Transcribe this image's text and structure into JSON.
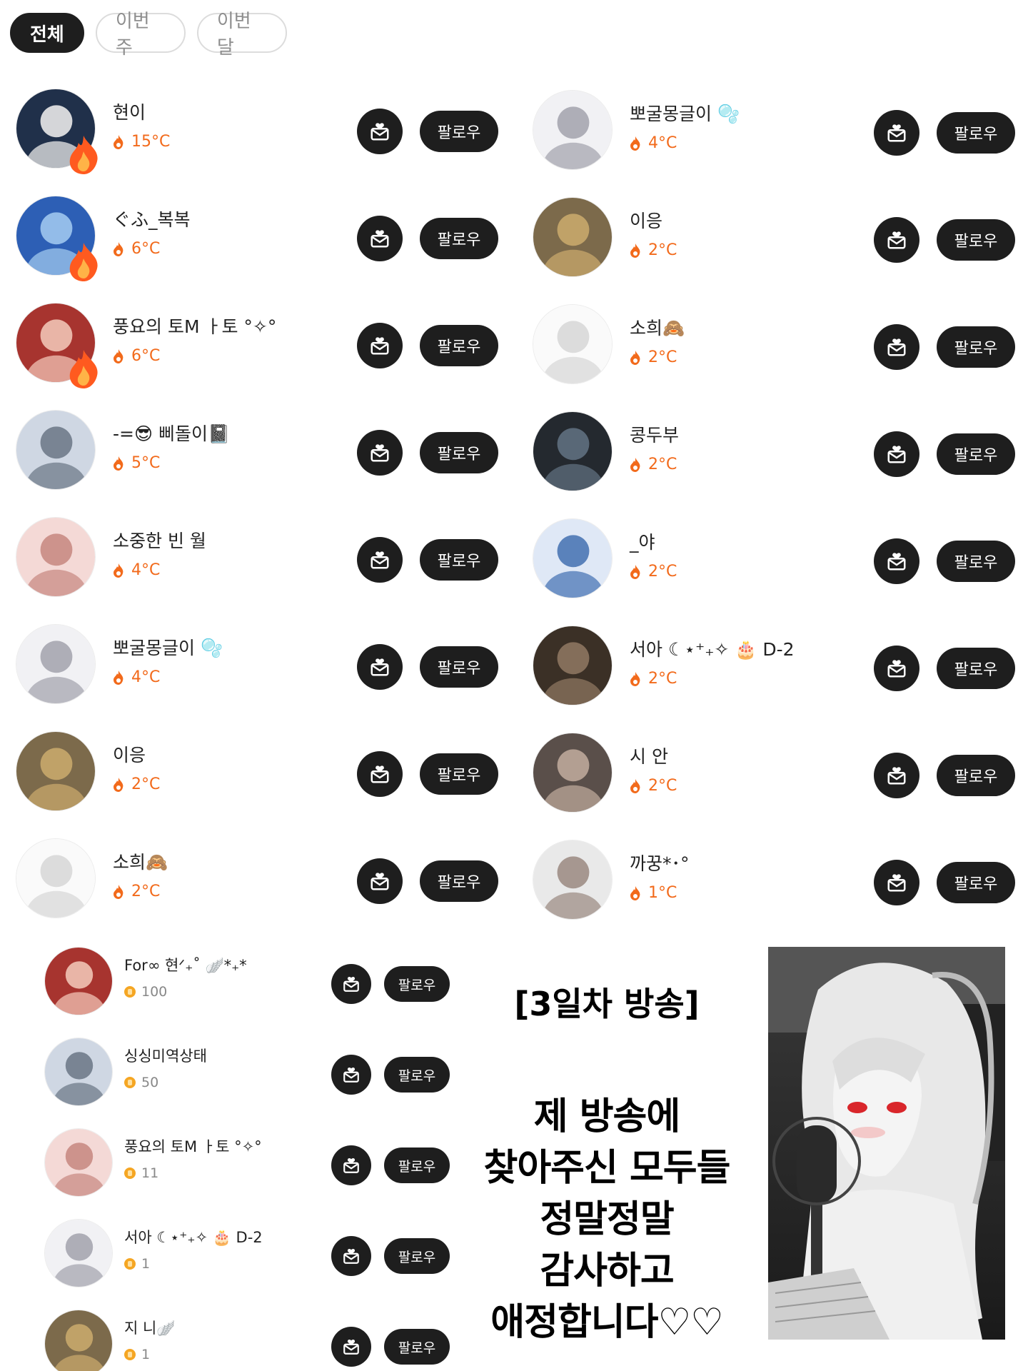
{
  "tabs": [
    {
      "label": "전체",
      "active": true
    },
    {
      "label": "이번 주",
      "active": false
    },
    {
      "label": "이번 달",
      "active": false
    }
  ],
  "follow_label": "팔로우",
  "left_list": [
    {
      "name": "현이",
      "temp": "15°C"
    },
    {
      "name": "ぐふ_복복",
      "temp": "6°C"
    },
    {
      "name": "풍요의 토M ㅏ토 °✧°",
      "temp": "6°C"
    },
    {
      "name": "-=😎 삐돌이📓",
      "temp": "5°C"
    },
    {
      "name": "소중한 빈 월",
      "temp": "4°C"
    },
    {
      "name": "뽀굴몽글이 🫧",
      "temp": "4°C"
    },
    {
      "name": "이응",
      "temp": "2°C"
    },
    {
      "name": "소희🙈",
      "temp": "2°C"
    }
  ],
  "right_list": [
    {
      "name": "뽀굴몽글이 🫧",
      "temp": "4°C"
    },
    {
      "name": "이응",
      "temp": "2°C"
    },
    {
      "name": "소희🙈",
      "temp": "2°C"
    },
    {
      "name": "콩두부",
      "temp": "2°C"
    },
    {
      "name": "_야",
      "temp": "2°C"
    },
    {
      "name": "서아 ☾⋆⁺₊✧ 🎂 D-2",
      "temp": "2°C"
    },
    {
      "name": "시 안",
      "temp": "2°C"
    },
    {
      "name": "까꿍*･°",
      "temp": "1°C"
    }
  ],
  "coin_list": [
    {
      "name": "For∞ 현ᐟ₊˚ 🪽*₊*",
      "coins": "100"
    },
    {
      "name": "싱싱미역상태",
      "coins": "50"
    },
    {
      "name": "풍요의 토M ㅏ토 °✧°",
      "coins": "11"
    },
    {
      "name": "서아 ☾⋆⁺₊✧ 🎂 D-2",
      "coins": "1"
    },
    {
      "name": "지 니🪽",
      "coins": "1"
    }
  ],
  "message": {
    "title": "[3일차 방송]",
    "lines": [
      "제 방송에",
      "찾아주신 모두들",
      "정말정말",
      "감사하고",
      "애정합니다♡♡"
    ]
  },
  "colors": {
    "accent_dark": "#1e1e1e",
    "temperature": "#f26a1b",
    "coin": "#f5a623"
  }
}
